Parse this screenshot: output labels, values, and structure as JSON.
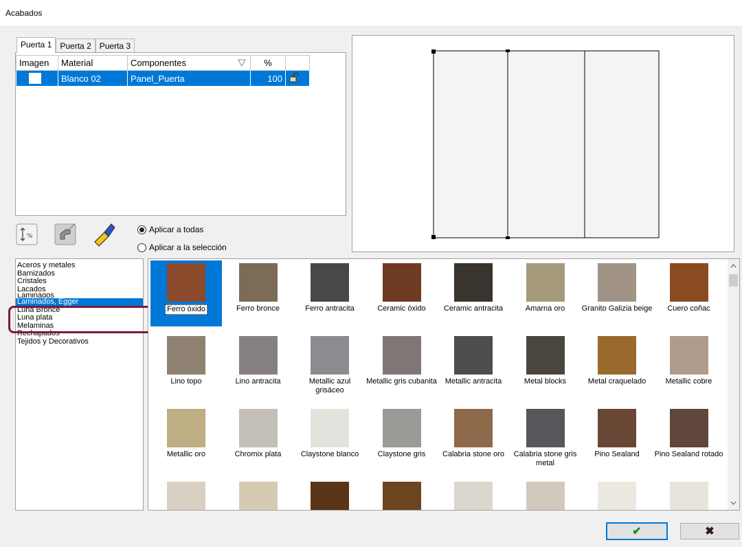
{
  "window": {
    "title": "Acabados"
  },
  "tabs": [
    "Puerta 1",
    "Puerta 2",
    "Puerta 3"
  ],
  "grid": {
    "headers": {
      "image": "Imagen",
      "material": "Material",
      "components": "Componentes",
      "percent": "%"
    },
    "row": {
      "material": "Blanco 02",
      "component": "Panel_Puerta",
      "percent": "100"
    }
  },
  "options": {
    "apply_all": "Aplicar a todas",
    "apply_selection": "Aplicar a la selección"
  },
  "categories": [
    "Aceros y metales",
    "Barnizados",
    "Cristales",
    "Lacados",
    "Laminados",
    "Laminados, Egger",
    "Luna Bronce",
    "Luna plata",
    "Melaminas",
    "Rechapados",
    "Tejidos y Decorativos"
  ],
  "selected_category": "Laminados, Egger",
  "materials": [
    {
      "label": "Ferro óxido",
      "color": "#8a4a2b",
      "selected": true
    },
    {
      "label": "Ferro bronce",
      "color": "#7c6b55"
    },
    {
      "label": "Ferro antracita",
      "color": "#4a4747"
    },
    {
      "label": "Ceramic óxido",
      "color": "#6e3a22"
    },
    {
      "label": "Ceramic antracita",
      "color": "#3a342e"
    },
    {
      "label": "Amarna oro",
      "color": "#a69a7c"
    },
    {
      "label": "Granito Galizia beige",
      "color": "#a19486"
    },
    {
      "label": "Cuero coñac",
      "color": "#8a4a22"
    },
    {
      "label": "Lino topo",
      "color": "#8f8273"
    },
    {
      "label": "Lino antracita",
      "color": "#878080"
    },
    {
      "label": "Metallic azul grisáceo",
      "color": "#8b8c8f"
    },
    {
      "label": "Metallic gris cubanita",
      "color": "#7e7776"
    },
    {
      "label": "Metallic antracita",
      "color": "#4d4d4f"
    },
    {
      "label": "Metal blocks",
      "color": "#4b4540"
    },
    {
      "label": "Metal craquelado",
      "color": "#9a6a2c"
    },
    {
      "label": "Metallic cobre",
      "color": "#b09b8a"
    },
    {
      "label": "Metallic oro",
      "color": "#bfae84"
    },
    {
      "label": "Chromix plata",
      "color": "#c3bfb7"
    },
    {
      "label": "Claystone blanco",
      "color": "#e3e2dc"
    },
    {
      "label": "Claystone gris",
      "color": "#9c9a96"
    },
    {
      "label": "Calabria stone oro",
      "color": "#8e6a4a"
    },
    {
      "label": "Calabria stone gris metal",
      "color": "#55575a"
    },
    {
      "label": "Pino Sealand",
      "color": "#6a4634"
    },
    {
      "label": "Pino Sealand rotado",
      "color": "#5e463a"
    },
    {
      "label": "",
      "color": "#d9cfc2"
    },
    {
      "label": "",
      "color": "#d7cab2"
    },
    {
      "label": "",
      "color": "#5b3518"
    },
    {
      "label": "",
      "color": "#6d4420"
    },
    {
      "label": "",
      "color": "#dcd7cc"
    },
    {
      "label": "",
      "color": "#d1c9bd"
    },
    {
      "label": "",
      "color": "#ece9e1"
    },
    {
      "label": "",
      "color": "#e8e4db"
    }
  ],
  "buttons": {
    "ok": "✔",
    "cancel": "✖"
  },
  "colors": {
    "selection": "#0078d7",
    "highlight": "#7a1a3d",
    "ok_green": "#1f8a1f",
    "cancel_dark": "#2b1a1a"
  }
}
